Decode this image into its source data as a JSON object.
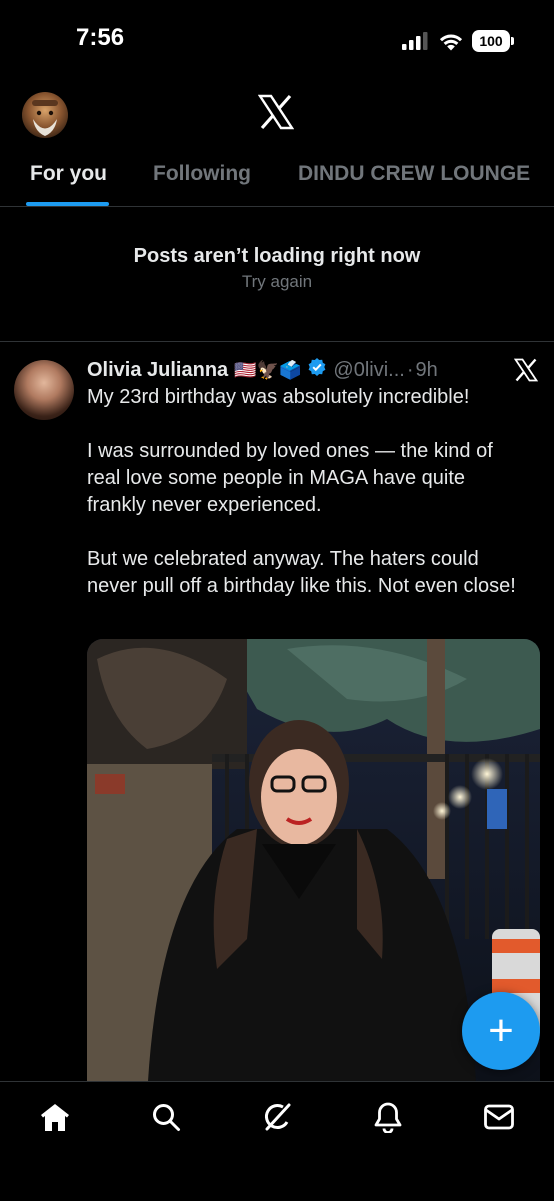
{
  "status_bar": {
    "time": "7:56",
    "battery": "100"
  },
  "header": {
    "logo_icon": "x-logo-icon",
    "avatar_icon": "user-avatar-icon"
  },
  "tabs": [
    {
      "label": "For you",
      "active": true
    },
    {
      "label": "Following",
      "active": false
    },
    {
      "label": "DINDU CREW LOUNGE",
      "active": false
    }
  ],
  "notice": {
    "title": "Posts aren’t loading right now",
    "retry": "Try again"
  },
  "post": {
    "name": "Olivia Julianna",
    "emojis": "🇺🇸🦅🗳️",
    "handle": "@0livi...",
    "separator": "·",
    "time": "9h",
    "paragraphs": [
      "My 23rd birthday was absolutely incredible!",
      "I was surrounded by loved ones — the kind of real love some people in MAGA have quite frankly never experienced.",
      "But we celebrated anyway. The haters could never pull off a birthday like this. Not even close!"
    ]
  },
  "fab": {
    "label": "+"
  },
  "bottom_nav": [
    {
      "icon": "home-icon"
    },
    {
      "icon": "search-icon"
    },
    {
      "icon": "grok-icon"
    },
    {
      "icon": "notifications-icon"
    },
    {
      "icon": "messages-icon"
    }
  ],
  "colors": {
    "background": "#000000",
    "accent": "#1d9bf0",
    "muted": "#71767b",
    "text": "#e7e9ea",
    "divider": "#2f3336"
  }
}
